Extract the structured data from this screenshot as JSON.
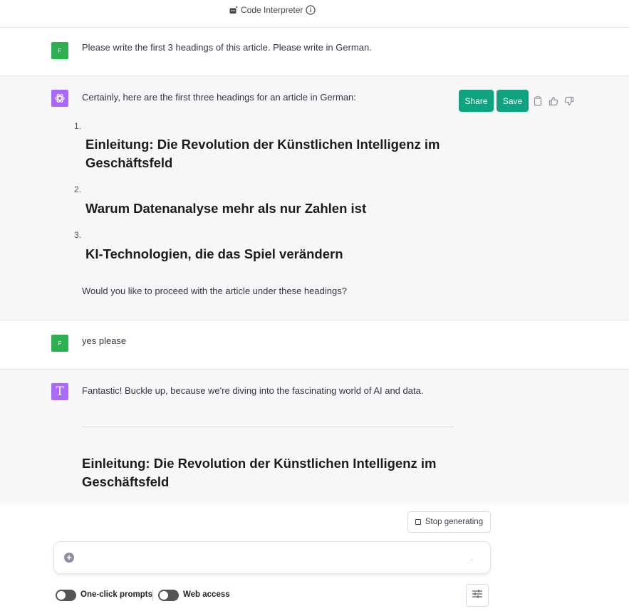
{
  "header": {
    "model_label": "Code Interpreter",
    "model_icon": "code-interpreter-icon",
    "info_icon": "info-icon"
  },
  "messages": {
    "user1": {
      "avatar_letter": "F",
      "text": "Please write the first 3 headings of this article. Please write in German."
    },
    "assistant1": {
      "intro": "Certainly, here are the first three headings for an article in German:",
      "items": [
        {
          "number": "1.",
          "heading_line1": "Einleitung: Die Revolution der Künstlichen Intelligenz im",
          "heading_line2": "Geschäftsfeld"
        },
        {
          "number": "2.",
          "heading_line1": "Warum Datenanalyse mehr als nur Zahlen ist"
        },
        {
          "number": "3.",
          "heading_line1": "KI-Technologien, die das Spiel verändern"
        }
      ],
      "outro": "Would you like to proceed with the article under these headings?",
      "share_label": "Share",
      "save_label": "Save"
    },
    "user2": {
      "avatar_letter": "F",
      "text": "yes please"
    },
    "assistant2": {
      "avatar_letter": "T",
      "intro": "Fantastic! Buckle up, because we're diving into the fascinating world of AI and data.",
      "heading_line1": "Einleitung: Die Revolution der Künstlichen Intelligenz im",
      "heading_line2": "Geschäftsfeld"
    }
  },
  "composer": {
    "stop_label": "Stop generating",
    "placeholder": "",
    "dot": "."
  },
  "footer": {
    "toggle1_label": "One-click prompts",
    "toggle2_label": "Web access"
  },
  "colors": {
    "accent": "#10a37f",
    "user_avatar": "#2cb052",
    "assistant_avatar": "#ab68ff"
  }
}
